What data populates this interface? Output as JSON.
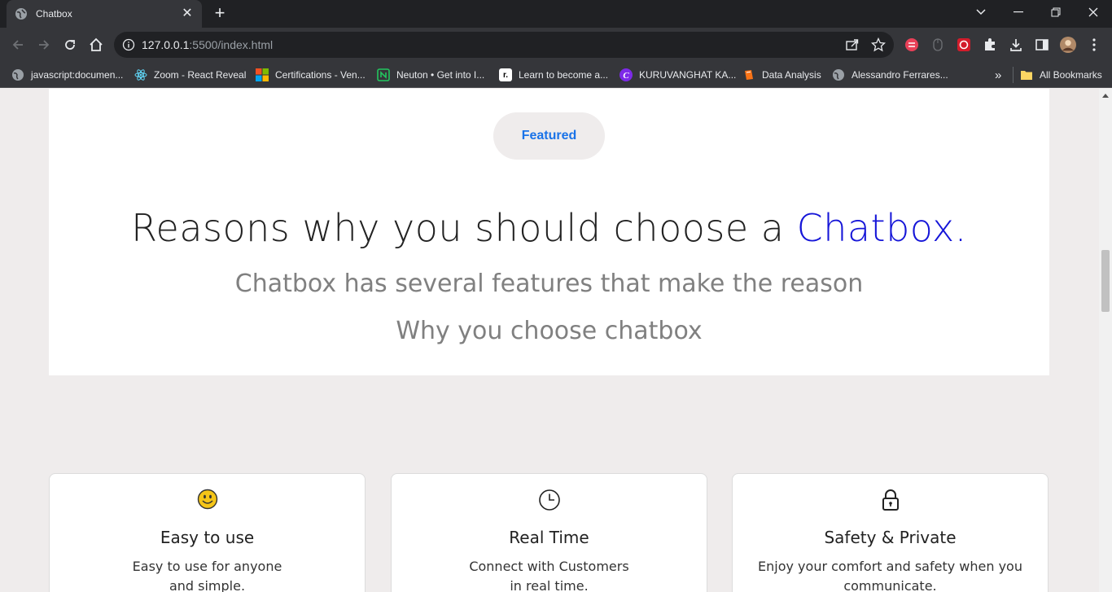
{
  "browser": {
    "tab_title": "Chatbox",
    "url_host": "127.0.0.1",
    "url_rest": ":5500/index.html",
    "bookmarks": [
      {
        "label": "javascript:documen...",
        "icon": "globe-icon"
      },
      {
        "label": "Zoom - React Reveal",
        "icon": "react-icon"
      },
      {
        "label": "Certifications - Ven...",
        "icon": "microsoft-icon"
      },
      {
        "label": "Neuton • Get into I...",
        "icon": "neuton-icon"
      },
      {
        "label": "Learn to become a...",
        "icon": "r-icon"
      },
      {
        "label": "KURUVANGHAT KA...",
        "icon": "canva-icon"
      },
      {
        "label": "Data Analysis",
        "icon": "book-icon"
      },
      {
        "label": "Alessandro Ferrares...",
        "icon": "globe-icon"
      }
    ],
    "bookmarks_overflow": "»",
    "all_bookmarks": "All Bookmarks"
  },
  "hero": {
    "badge": "Featured",
    "headline_main": "Reasons why you should choose a ",
    "headline_accent": "Chatbox.",
    "subline_1": "Chatbox has several features that make the reason",
    "subline_2": "Why you choose chatbox"
  },
  "features": [
    {
      "icon": "smiley-icon",
      "title": "Easy to use",
      "line1": "Easy to use for anyone",
      "line2": "and simple."
    },
    {
      "icon": "clock-icon",
      "title": "Real Time",
      "line1": "Connect with Customers",
      "line2": "in real time."
    },
    {
      "icon": "lock-icon",
      "title": "Safety & Private",
      "line1": "Enjoy your comfort and safety when you",
      "line2": "communicate."
    }
  ],
  "colors": {
    "accent": "#1515d8",
    "badge_text": "#1a73e8",
    "page_bg": "#efecec"
  }
}
